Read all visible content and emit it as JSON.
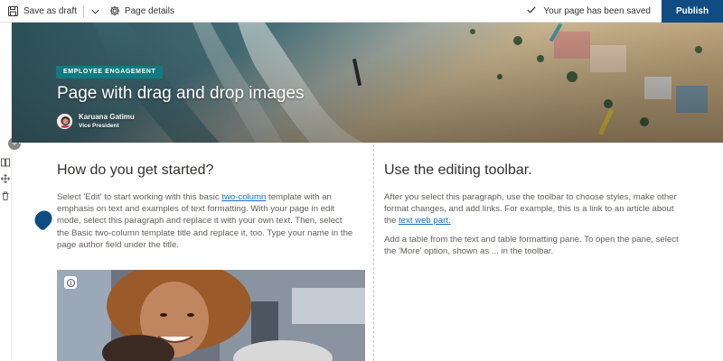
{
  "command_bar": {
    "save_draft_label": "Save as draft",
    "page_details_label": "Page details",
    "saved_status": "Your page has been saved",
    "publish_label": "Publish",
    "icons": [
      "save-icon",
      "chevron-down-icon",
      "gear-icon",
      "checkmark-icon"
    ]
  },
  "rail": {
    "icons": [
      "add-section-icon",
      "edit-section-icon",
      "move-icon",
      "delete-icon"
    ]
  },
  "hero": {
    "topic_header": "EMPLOYEE ENGAGEMENT",
    "title": "Page with drag and drop images",
    "author_name": "Karuana Gatimu",
    "author_role": "Vice President"
  },
  "left_column": {
    "heading": "How do you get started?",
    "para_part1": "Select 'Edit' to start working with this basic ",
    "link": "two-column",
    "para_part2": " template with an emphasis on text and examples of text formatting. With your page in edit mode, select this paragraph and replace it with your own text. Then, select the Basic two-column template title and replace it, too. Type your name in the page author field under the title."
  },
  "right_column": {
    "heading": "Use the editing toolbar.",
    "para1_part1": "After you select this paragraph, use the toolbar to choose styles, make other format changes, and add links. For example, this is a link to an article about the ",
    "para1_link": "text web part.",
    "para2": "Add a table from the text and table formatting pane. To open the pane, select the 'More' option, shown as ... in the toolbar."
  },
  "colors": {
    "publish_bg": "#0f4c81",
    "topic_bg": "#137a80",
    "link": "#0f6cbd",
    "text": "#605e5c"
  }
}
